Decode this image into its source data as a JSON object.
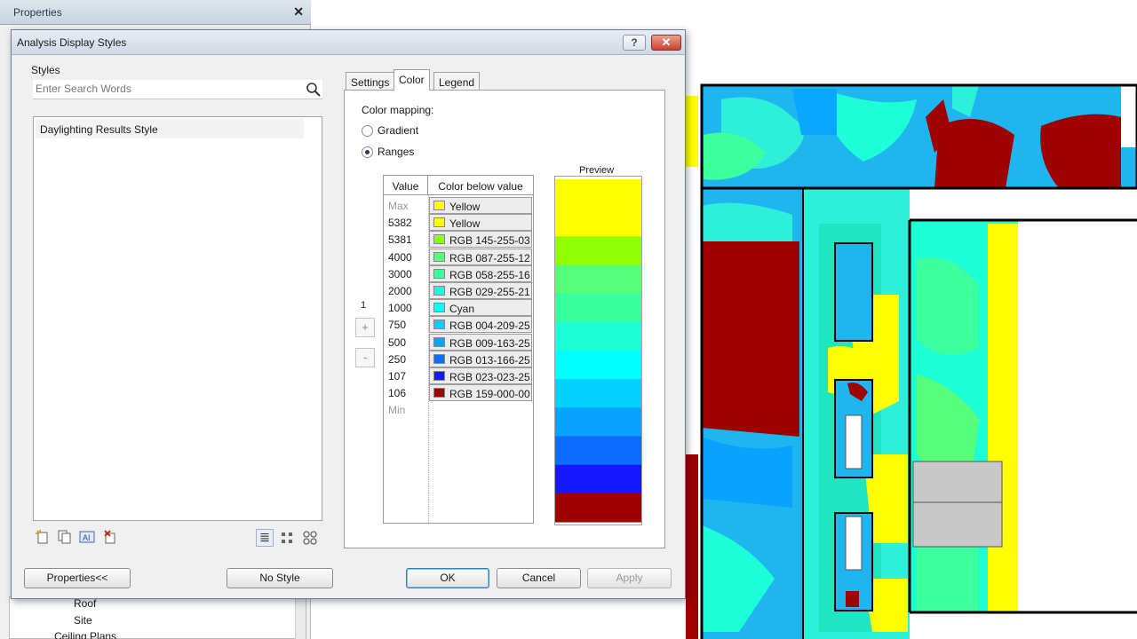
{
  "background": {
    "properties_title": "Properties",
    "tree_items": [
      "Roof",
      "Site",
      "Ceiling Plans"
    ]
  },
  "dialog": {
    "title": "Analysis Display Styles",
    "styles_label": "Styles",
    "search_placeholder": "Enter Search Words",
    "style_items": [
      "Daylighting Results Style"
    ],
    "tabs": [
      {
        "label": "Settings",
        "active": false
      },
      {
        "label": "Color",
        "active": true
      },
      {
        "label": "Legend",
        "active": false
      }
    ],
    "color_mapping_label": "Color mapping:",
    "gradient_label": "Gradient",
    "ranges_label": "Ranges",
    "selected_mapping": "Ranges",
    "table": {
      "col_value": "Value",
      "col_color": "Color below value",
      "rows": [
        {
          "value": "Max",
          "color_name": "Yellow",
          "hex": "#ffff00"
        },
        {
          "value": "5382",
          "color_name": "Yellow",
          "hex": "#ffff00"
        },
        {
          "value": "5381",
          "color_name": "RGB 145-255-03",
          "hex": "#91ff03"
        },
        {
          "value": "4000",
          "color_name": "RGB 087-255-12",
          "hex": "#57ff7a"
        },
        {
          "value": "3000",
          "color_name": "RGB 058-255-16",
          "hex": "#3aff9f"
        },
        {
          "value": "2000",
          "color_name": "RGB 029-255-21",
          "hex": "#1dffd6"
        },
        {
          "value": "1000",
          "color_name": "Cyan",
          "hex": "#00ffff"
        },
        {
          "value": "750",
          "color_name": "RGB 004-209-25",
          "hex": "#04d1ff"
        },
        {
          "value": "500",
          "color_name": "RGB 009-163-25",
          "hex": "#09a3ff"
        },
        {
          "value": "250",
          "color_name": "RGB 013-166-25",
          "hex": "#0d6dff"
        },
        {
          "value": "107",
          "color_name": "RGB 023-023-25",
          "hex": "#1717ff"
        },
        {
          "value": "106",
          "color_name": "RGB 159-000-00",
          "hex": "#9f0000"
        },
        {
          "value": "Min",
          "color_name": "",
          "hex": ""
        }
      ]
    },
    "row_index": "1",
    "add_label": "+",
    "remove_label": "-",
    "preview_label": "Preview",
    "preview_colors": [
      "#ffff00",
      "#ffff00",
      "#91ff03",
      "#57ff7a",
      "#3aff9f",
      "#1dffd6",
      "#00ffff",
      "#04d1ff",
      "#09a3ff",
      "#0d6dff",
      "#1717ff",
      "#9f0000"
    ],
    "buttons": {
      "properties": "Properties<<",
      "no_style": "No Style",
      "ok": "OK",
      "cancel": "Cancel",
      "apply": "Apply"
    }
  }
}
